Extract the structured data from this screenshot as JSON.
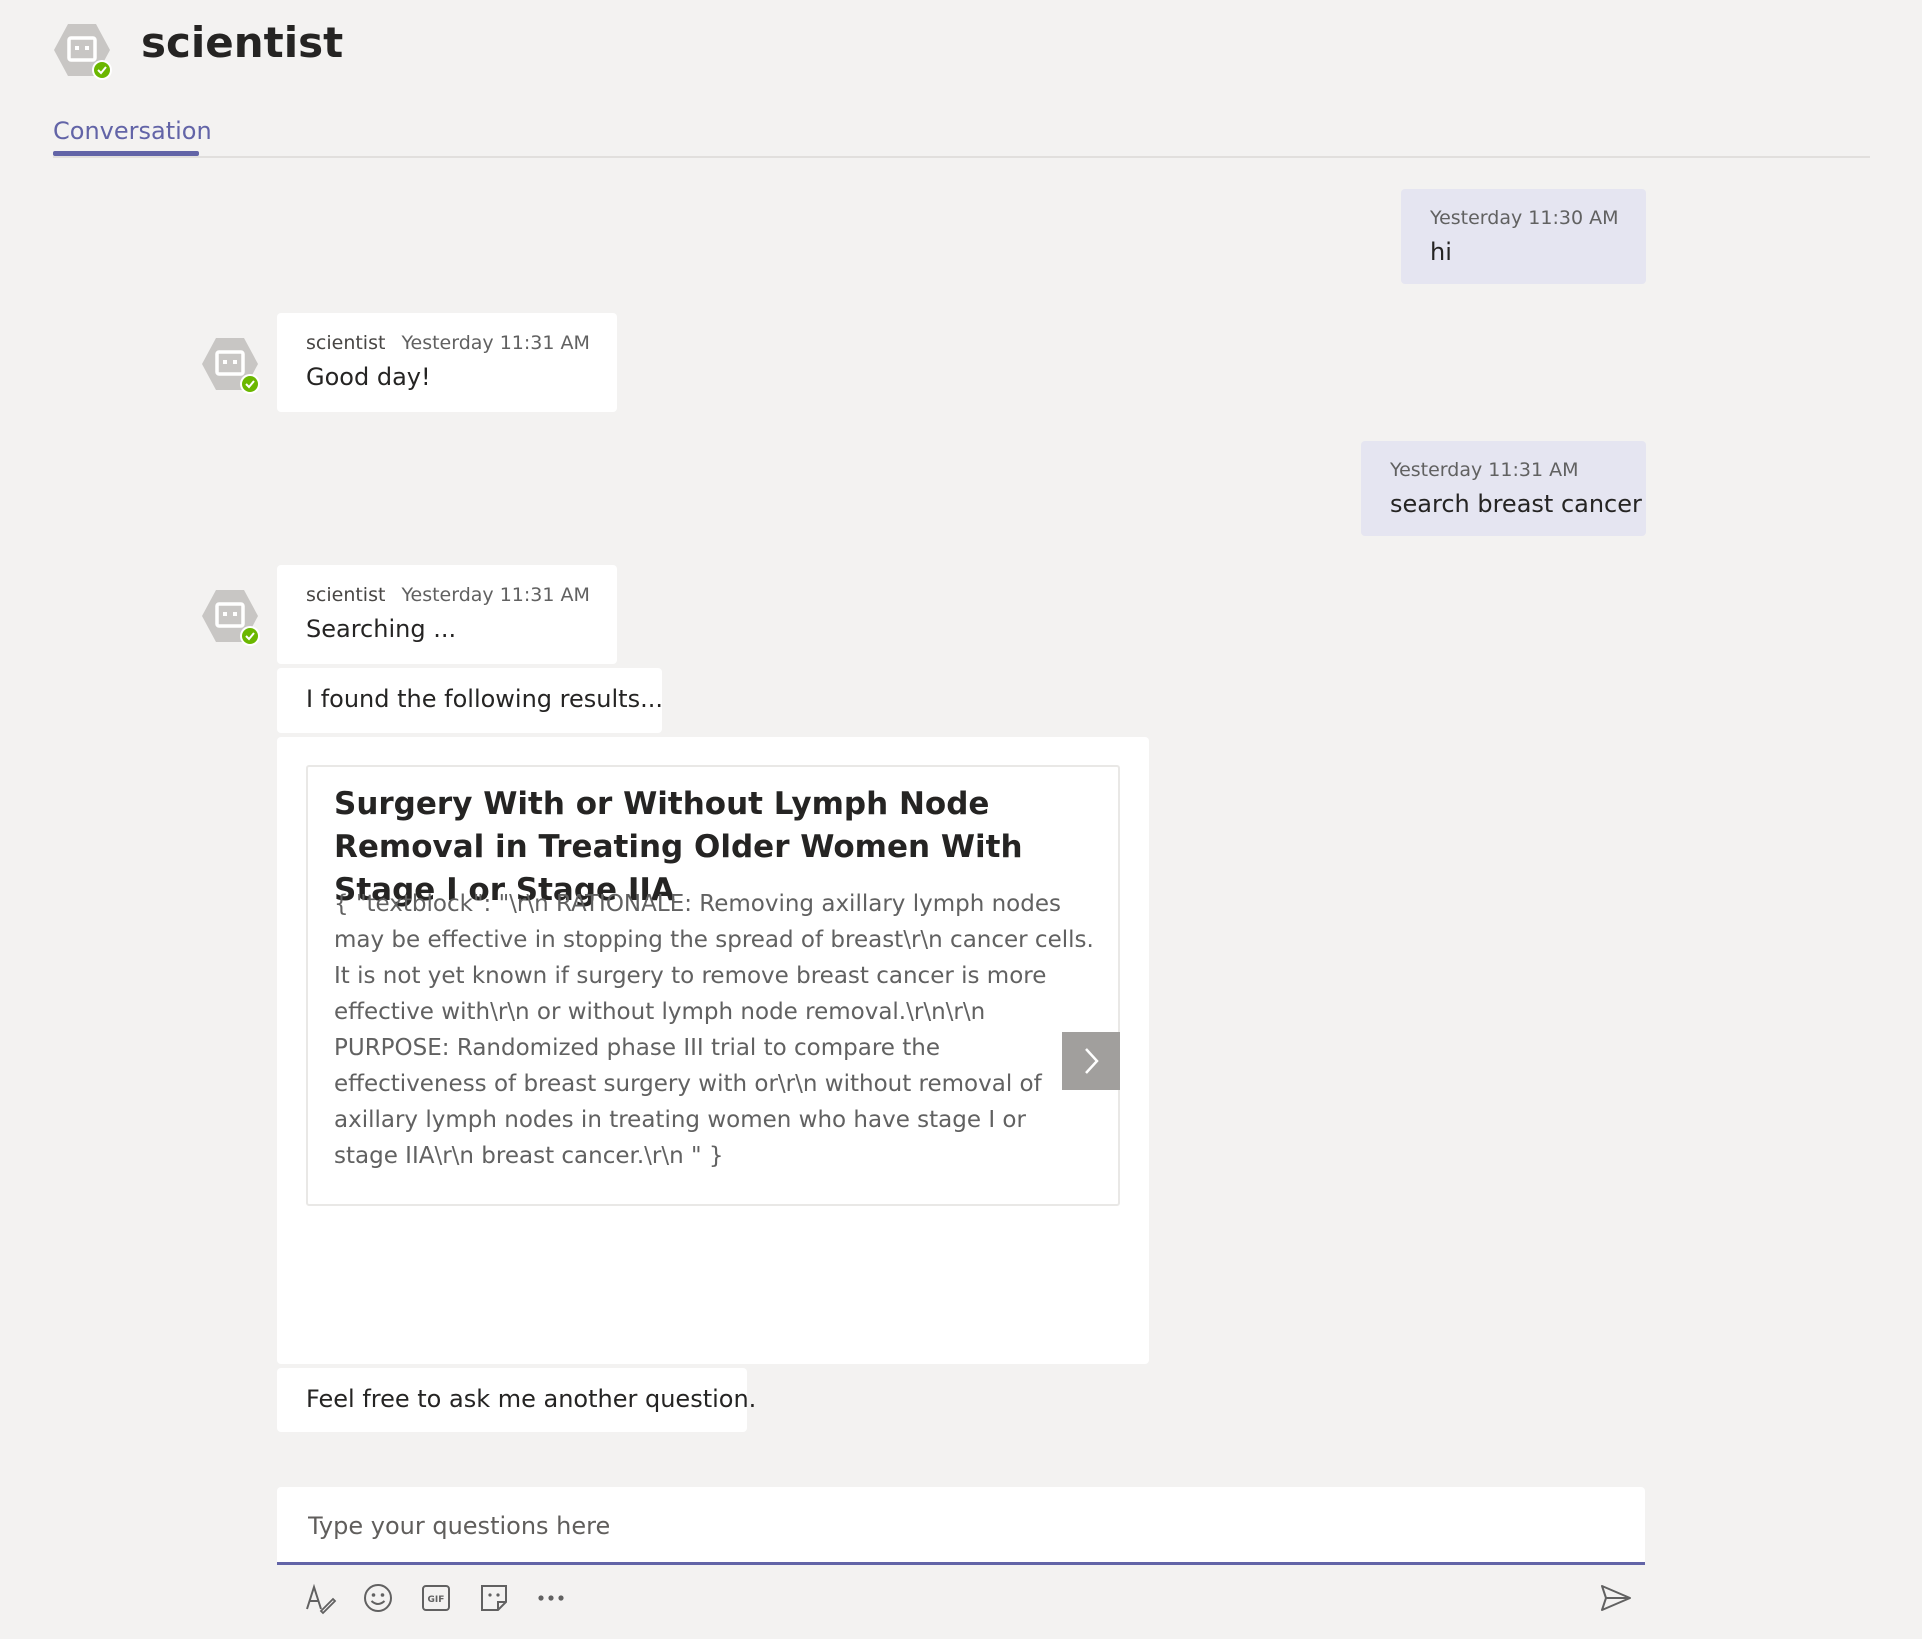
{
  "header": {
    "title": "scientist",
    "avatar_icon": "bot-icon",
    "status_icon": "available-check-icon"
  },
  "tabs": [
    {
      "label": "Conversation",
      "active": true
    }
  ],
  "messages": [
    {
      "from": "user",
      "time": "Yesterday 11:30 AM",
      "text": "hi"
    },
    {
      "from": "bot",
      "sender": "scientist",
      "time": "Yesterday 11:31 AM",
      "text": "Good day!"
    },
    {
      "from": "user",
      "time": "Yesterday 11:31 AM",
      "text": "search breast cancer"
    },
    {
      "from": "bot",
      "sender": "scientist",
      "time": "Yesterday 11:31 AM",
      "text": "Searching ..."
    }
  ],
  "bot_followups": {
    "found_text": "I found the following results...",
    "ask_text": "Feel free to ask me another question."
  },
  "card": {
    "title": "Surgery With or Without Lymph Node Removal in Treating Older Women With Stage I or Stage IIA",
    "body": "{ \"textblock\": \"\\r\\n RATIONALE: Removing axillary lymph nodes may be effective in stopping the spread of breast\\r\\n cancer cells. It is not yet known if surgery to remove breast cancer is more effective with\\r\\n or without lymph node removal.\\r\\n\\r\\n PURPOSE: Randomized phase III trial to compare the effectiveness of breast surgery with or\\r\\n without removal of axillary lymph nodes in treating women who have stage I or stage IIA\\r\\n breast cancer.\\r\\n \" }",
    "next_icon": "chevron-right-icon"
  },
  "composer": {
    "placeholder": "Type your questions here",
    "value": "",
    "tools": [
      "format-icon",
      "emoji-icon",
      "gif-icon",
      "sticker-icon",
      "more-options-icon"
    ],
    "send_icon": "send-icon"
  },
  "colors": {
    "accent": "#6264a7",
    "self_bubble": "#e5e5f1",
    "background": "#f3f2f1",
    "status_available": "#6bb700"
  }
}
